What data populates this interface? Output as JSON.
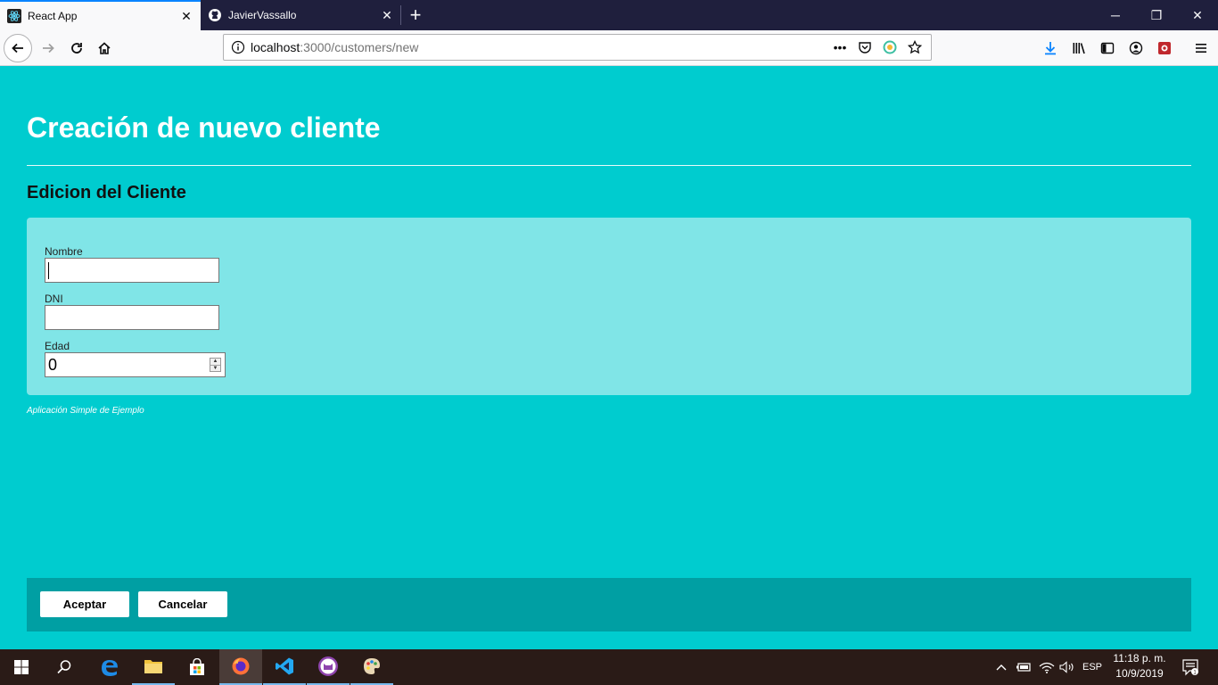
{
  "browser": {
    "tabs": [
      {
        "label": "React App",
        "icon": "react-icon",
        "active": true
      },
      {
        "label": "JavierVassallo",
        "icon": "github-icon",
        "active": false
      }
    ],
    "url": {
      "host": "localhost",
      "rest": ":3000/customers/new"
    },
    "window_controls": {
      "minimize": "─",
      "restore": "❐",
      "close": "✕"
    }
  },
  "page": {
    "title": "Creación de nuevo cliente",
    "subtitle": "Edicion del Cliente",
    "form": {
      "fields": [
        {
          "label": "Nombre",
          "value": ""
        },
        {
          "label": "DNI",
          "value": ""
        },
        {
          "label": "Edad",
          "value": "0"
        }
      ]
    },
    "footer_note": "Aplicación Simple de Ejemplo",
    "actions": {
      "accept": "Aceptar",
      "cancel": "Cancelar"
    }
  },
  "taskbar": {
    "language": "ESP",
    "time": "11:18 p. m.",
    "date": "10/9/2019",
    "notification_count": "1"
  },
  "colors": {
    "page_background": "#00cccf",
    "form_panel": "#80e5e7",
    "action_bar": "#009fa3",
    "tab_accent": "#0a84ff"
  }
}
